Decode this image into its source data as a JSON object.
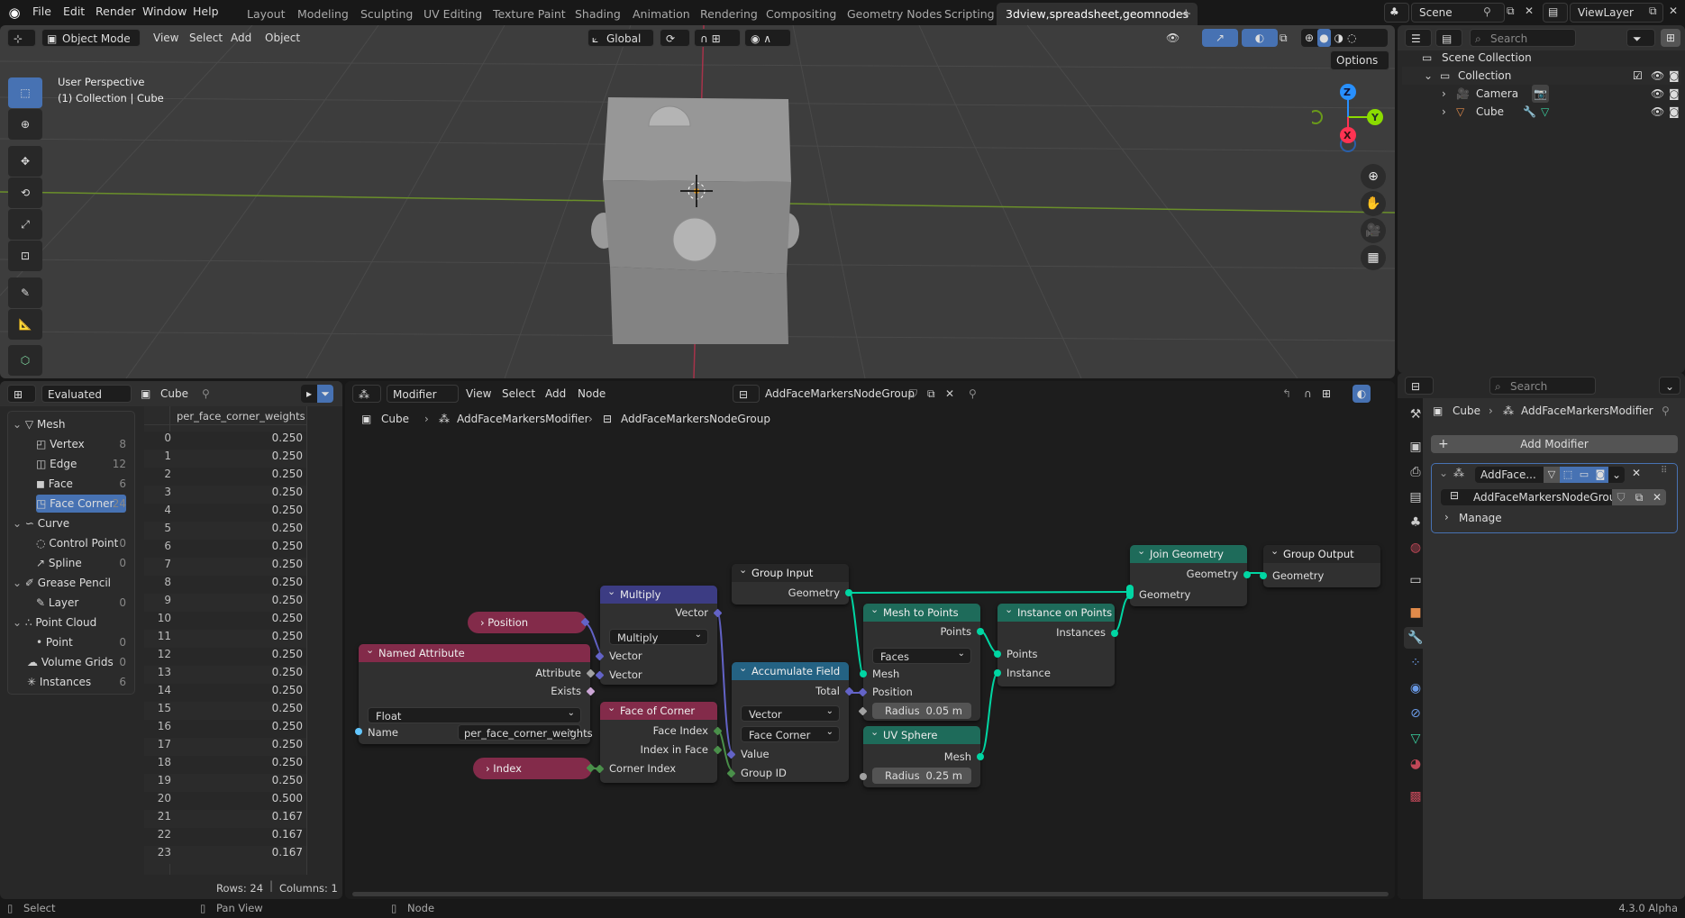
{
  "topbar": {
    "menus": [
      "File",
      "Edit",
      "Render",
      "Window",
      "Help"
    ],
    "workspaces": [
      "Layout",
      "Modeling",
      "Sculpting",
      "UV Editing",
      "Texture Paint",
      "Shading",
      "Animation",
      "Rendering",
      "Compositing",
      "Geometry Nodes",
      "Scripting",
      "3dview,spreadsheet,geomnodes"
    ],
    "active_workspace": "3dview,spreadsheet,geomnodes",
    "add_tab": "+",
    "scene": "Scene",
    "view_layer": "ViewLayer"
  },
  "viewport": {
    "mode": "Object Mode",
    "menus": [
      "View",
      "Select",
      "Add",
      "Object"
    ],
    "orientation": "Global",
    "options_label": "Options",
    "overlay_line1": "User Perspective",
    "overlay_line2": "(1) Collection | Cube",
    "gizmo_axes": {
      "x": "X",
      "y": "Y",
      "z": "Z"
    },
    "colors": {
      "x": "#ff3352",
      "y": "#8bdc00",
      "z": "#2890ff"
    }
  },
  "outliner": {
    "search_placeholder": "Search",
    "root": "Scene Collection",
    "collection": "Collection",
    "objects": [
      {
        "name": "Camera"
      },
      {
        "name": "Cube"
      }
    ]
  },
  "spreadsheet": {
    "mode": "Evaluated",
    "object": "Cube",
    "tree": [
      {
        "label": "Mesh",
        "group": true
      },
      {
        "label": "Vertex",
        "count": "8"
      },
      {
        "label": "Edge",
        "count": "12"
      },
      {
        "label": "Face",
        "count": "6"
      },
      {
        "label": "Face Corner",
        "count": "24",
        "selected": true
      },
      {
        "label": "Curve",
        "group": true
      },
      {
        "label": "Control Point",
        "count": "0"
      },
      {
        "label": "Spline",
        "count": "0"
      },
      {
        "label": "Grease Pencil",
        "group": true
      },
      {
        "label": "Layer",
        "count": "0"
      },
      {
        "label": "Point Cloud",
        "group": true
      },
      {
        "label": "Point",
        "count": "0"
      },
      {
        "label": "Volume Grids",
        "count": "0",
        "top": true
      },
      {
        "label": "Instances",
        "count": "6",
        "top": true
      }
    ],
    "column": "per_face_corner_weights",
    "rows": [
      "0.250",
      "0.250",
      "0.250",
      "0.250",
      "0.250",
      "0.250",
      "0.250",
      "0.250",
      "0.250",
      "0.250",
      "0.250",
      "0.250",
      "0.250",
      "0.250",
      "0.250",
      "0.250",
      "0.250",
      "0.250",
      "0.250",
      "0.250",
      "0.500",
      "0.167",
      "0.167",
      "0.167"
    ],
    "footer_rows": "Rows: 24",
    "footer_cols": "Columns: 1"
  },
  "node_editor": {
    "context": "Modifier",
    "menus": [
      "View",
      "Select",
      "Add",
      "Node"
    ],
    "node_group": "AddFaceMarkersNodeGroup",
    "breadcrumb": [
      "Cube",
      "AddFaceMarkersModifier",
      "AddFaceMarkersNodeGroup"
    ],
    "nodes": {
      "position": "Position",
      "index": "Index",
      "named_attribute": {
        "title": "Named Attribute",
        "out_attribute": "Attribute",
        "out_exists": "Exists",
        "type": "Float",
        "name_label": "Name",
        "name_value": "per_face_corner_weights"
      },
      "multiply": {
        "title": "Multiply",
        "out": "Vector",
        "op": "Multiply",
        "in1": "Vector",
        "in2": "Vector"
      },
      "face_of_corner": {
        "title": "Face of Corner",
        "out1": "Face Index",
        "out2": "Index in Face",
        "in": "Corner Index"
      },
      "group_input": {
        "title": "Group Input",
        "out": "Geometry"
      },
      "accumulate": {
        "title": "Accumulate Field",
        "out": "Total",
        "type": "Vector",
        "domain": "Face Corner",
        "in1": "Value",
        "in2": "Group ID"
      },
      "mesh_to_points": {
        "title": "Mesh to Points",
        "out": "Points",
        "mode": "Faces",
        "in1": "Mesh",
        "in2": "Position",
        "radius_label": "Radius",
        "radius": "0.05 m"
      },
      "uv_sphere": {
        "title": "UV Sphere",
        "out": "Mesh",
        "radius_label": "Radius",
        "radius": "0.25 m"
      },
      "instance_on_points": {
        "title": "Instance on Points",
        "out": "Instances",
        "in1": "Points",
        "in2": "Instance"
      },
      "join_geometry": {
        "title": "Join Geometry",
        "out": "Geometry",
        "in": "Geometry"
      },
      "group_output": {
        "title": "Group Output",
        "in": "Geometry"
      }
    }
  },
  "properties": {
    "search_placeholder": "Search",
    "breadcrumb": [
      "Cube",
      "AddFaceMarkersModifier"
    ],
    "add_modifier": "Add Modifier",
    "modifier_name": "AddFace...",
    "node_group": "AddFaceMarkersNodeGroup",
    "manage": "Manage"
  },
  "status": {
    "select": "Select",
    "pan": "Pan View",
    "node": "Node",
    "version": "4.3.0 Alpha"
  }
}
